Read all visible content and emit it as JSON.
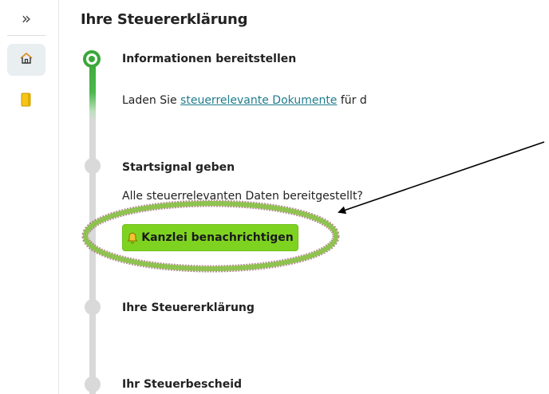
{
  "sidebar": {
    "expand_label": "»",
    "items": [
      {
        "name": "home",
        "icon": "home-icon",
        "active": true
      },
      {
        "name": "documents",
        "icon": "document-icon",
        "active": false
      }
    ]
  },
  "main": {
    "title": "Ihre Steuererklärung",
    "steps": [
      {
        "title": "Informationen bereitstellen",
        "text_before": "Laden Sie ",
        "link": "steuerrelevante Dokumente",
        "text_after": " für d",
        "status": "active"
      },
      {
        "title": "Startsignal geben",
        "text": "Alle steuerrelevanten Daten bereitgestellt?",
        "button_label": "Kanzlei benachrichtigen",
        "status": "pending"
      },
      {
        "title": "Ihre Steuererklärung",
        "status": "pending"
      },
      {
        "title": "Ihr Steuerbescheid",
        "status": "pending"
      }
    ]
  },
  "colors": {
    "accent_green": "#3aa83a",
    "button_green": "#7ed321",
    "link": "#1f7c8c",
    "annotation_ring": "#8bc34a"
  }
}
